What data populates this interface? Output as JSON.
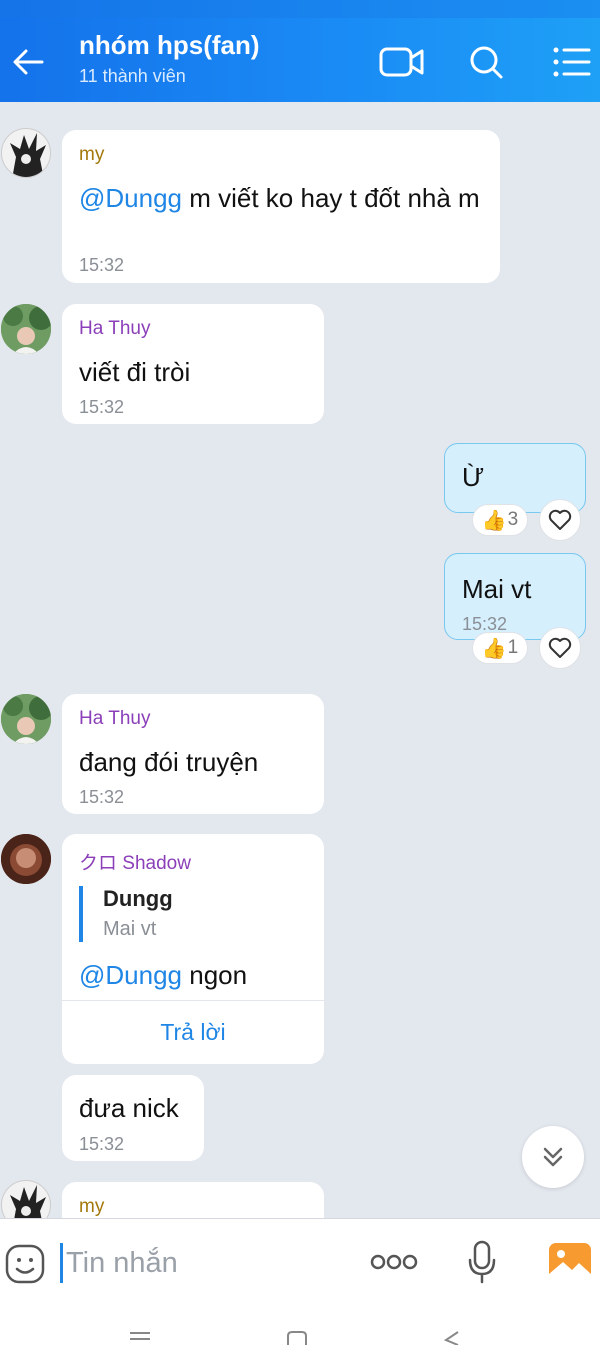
{
  "header": {
    "title": "nhóm hps(fan)",
    "subtitle": "11 thành viên"
  },
  "messages": [
    {
      "sender": "my",
      "sender_color": "#a3790c",
      "mention": "@Dungg",
      "text": " m viết ko hay t đốt nhà m",
      "time": "15:32"
    },
    {
      "sender": "Ha Thuy",
      "sender_color": "#8b3fb8",
      "text": "viết đi tròi",
      "time": "15:32"
    },
    {
      "text": "Ừ",
      "reactions": {
        "like_count": "3"
      }
    },
    {
      "text": "Mai vt",
      "time": "15:32",
      "reactions": {
        "like_count": "1"
      }
    },
    {
      "sender": "Ha Thuy",
      "sender_color": "#8b3fb8",
      "text": "đang đói truyện",
      "time": "15:32"
    },
    {
      "sender": "クロ Shadow",
      "sender_color": "#8b3fb8",
      "quote_author": "Dungg",
      "quote_text": "Mai vt",
      "mention": "@Dungg",
      "text": " ngon",
      "reply_label": "Trả lời"
    },
    {
      "text": "đưa nick",
      "time": "15:32"
    },
    {
      "sender": "my",
      "sender_color": "#a3790c"
    }
  ],
  "composer": {
    "placeholder": "Tin nhắn"
  },
  "colors": {
    "accent": "#1f86e6",
    "header_start": "#1472ea",
    "header_end": "#1ea0f6",
    "mine_bubble": "#d5effd",
    "chat_bg": "#e3e7ee"
  }
}
